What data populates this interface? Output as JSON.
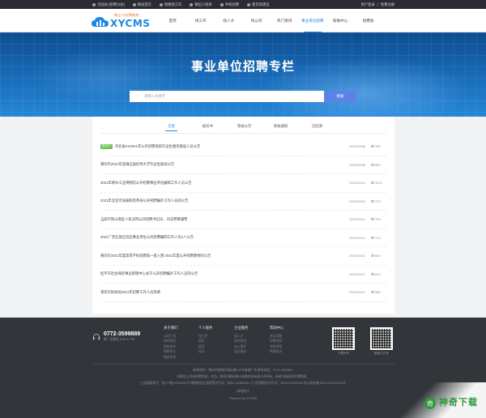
{
  "topbar": {
    "items": [
      {
        "icon": "location-icon",
        "label": "全国站 [招聘分站]"
      },
      {
        "icon": "home-icon",
        "label": "网站首页"
      },
      {
        "icon": "map-icon",
        "label": "地图找工作"
      },
      {
        "icon": "wechat-icon",
        "label": "微信小程序"
      },
      {
        "icon": "mobile-icon",
        "label": "手机招聘"
      },
      {
        "icon": "feedback-icon",
        "label": "意见和建议"
      }
    ],
    "user": {
      "login": "用户登录",
      "sep": "|",
      "register": "免费注册"
    }
  },
  "logo": {
    "tag": "做让人才招聘系统",
    "word": "XYCMS"
  },
  "nav": [
    {
      "label": "首页",
      "active": false
    },
    {
      "label": "找工作",
      "active": false
    },
    {
      "label": "找人才",
      "active": false
    },
    {
      "label": "找公司",
      "active": false
    },
    {
      "label": "热门资讯",
      "active": false
    },
    {
      "label": "事业单位招聘",
      "active": true
    },
    {
      "label": "帮助中心",
      "active": false
    },
    {
      "label": "招聘会",
      "active": false
    }
  ],
  "hero": {
    "title": "事业单位招聘专栏",
    "search_placeholder": "请输入关键字",
    "search_button": "搜索"
  },
  "tabs": [
    {
      "label": "全部",
      "active": true
    },
    {
      "label": "报名中",
      "active": false
    },
    {
      "label": "等候公示",
      "active": false
    },
    {
      "label": "等候通知",
      "active": false
    },
    {
      "label": "已结束",
      "active": false
    }
  ],
  "rows": [
    {
      "badge": "报名中",
      "title": "河北省XX2021年公开招聘高校毕业生服务基层人员公告",
      "date": "2021/05/08",
      "views": "755"
    },
    {
      "badge": "",
      "title": "黄冈市2021年选调应届优秀大学毕业生面试公告",
      "date": "2021/05/08",
      "views": "563"
    },
    {
      "badge": "",
      "title": "2021年柳州工业博物馆公开招聘事业单位编制工作人员公告",
      "date": "2021/04/13",
      "views": "1129"
    },
    {
      "badge": "",
      "title": "2021年北流市发展和改革局公开招聘编外工作人员的公告",
      "date": "2021/04/13",
      "views": "723"
    },
    {
      "badge": "",
      "title": "玉屏市铁山港区人民法院公开招聘书记员、司法警察辅警",
      "date": "2021/04/11",
      "views": "793"
    },
    {
      "badge": "",
      "title": "2021广西壮族自治区事业单位公开招聘编制工作人员1人公告",
      "date": "2021/04/11",
      "views": "712"
    },
    {
      "badge": "",
      "title": "黄冈市2021年度高等学校招聘第一批入围 2021年度公开招聘教师的公告",
      "date": "2021/04/11",
      "views": "644"
    },
    {
      "badge": "",
      "title": "桂平市社会保险事业管理中心关于公开招聘编外工作人员的公告",
      "date": "2021/04/11",
      "views": "613"
    },
    {
      "badge": "",
      "title": "来宾市民政局2021年招聘工作人员简章",
      "date": "2021/04/11",
      "views": "680"
    }
  ],
  "footer": {
    "phone": "0772-3599889",
    "hours": "周一至周五 9:00-17:00",
    "cols": [
      {
        "head": "关于我们",
        "links": [
          "公司介绍",
          "联系我们",
          "网站合作",
          "帮助中心",
          "服务协议"
        ]
      },
      {
        "head": "个人服务",
        "links": [
          "找工作",
          "简历",
          "面试",
          "培训"
        ]
      },
      {
        "head": "企业服务",
        "links": [
          "找人才",
          "发布职位",
          "加入我们",
          "会员服务"
        ]
      },
      {
        "head": "帮助中心",
        "links": [
          "常见问题",
          "招聘须知",
          "求职须知",
          "举报投诉"
        ]
      }
    ],
    "qr1_caption": "下载APP",
    "qr2_caption": "微信公众号",
    "line1": "联系地址：柳州市柳南区城站路129号某城广场  联系电话：0772-3599889",
    "line2": "本网站上所有招聘信息，作品，版权归柳州骑士网络科技有限公司所有，未经书面授权不得转载。",
    "line3": "工信部备案号：桂ICP备10004500号  增值电信业务经营许可证：桂B2-20080089  人力资源服务许可证：4502012009008  桂公网安备45020402000123号",
    "line4": "网站统计",
    "line5": "Powered by XYCMS"
  },
  "watermark": {
    "glyph": "奇",
    "text": "神奇下载"
  }
}
